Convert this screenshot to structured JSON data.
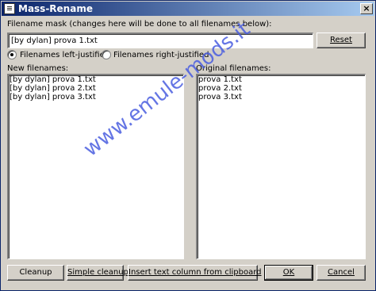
{
  "window": {
    "title": "Mass-Rename",
    "close_symbol": "×",
    "icon": "rename-app-icon"
  },
  "mask": {
    "label": "Filename mask (changes here will be done to all filenames below):",
    "value": "[by dylan] prova 1.txt",
    "reset_label": "Reset"
  },
  "justify": {
    "left_label": "Filenames left-justified",
    "right_label": "Filenames right-justified",
    "selected": "left"
  },
  "new_files": {
    "label": "New filenames:",
    "items": [
      "[by dylan] prova 1.txt",
      "[by dylan] prova 2.txt",
      "[by dylan] prova 3.txt"
    ]
  },
  "original_files": {
    "label": "Original filenames:",
    "items": [
      "prova 1.txt",
      "prova 2.txt",
      "prova 3.txt"
    ]
  },
  "buttons": {
    "cleanup": "Cleanup",
    "simple_cleanup": "Simple cleanup",
    "insert_column": "Insert text column from clipboard",
    "ok": "OK",
    "cancel": "Cancel"
  },
  "watermark": "www.emule-mods.it"
}
